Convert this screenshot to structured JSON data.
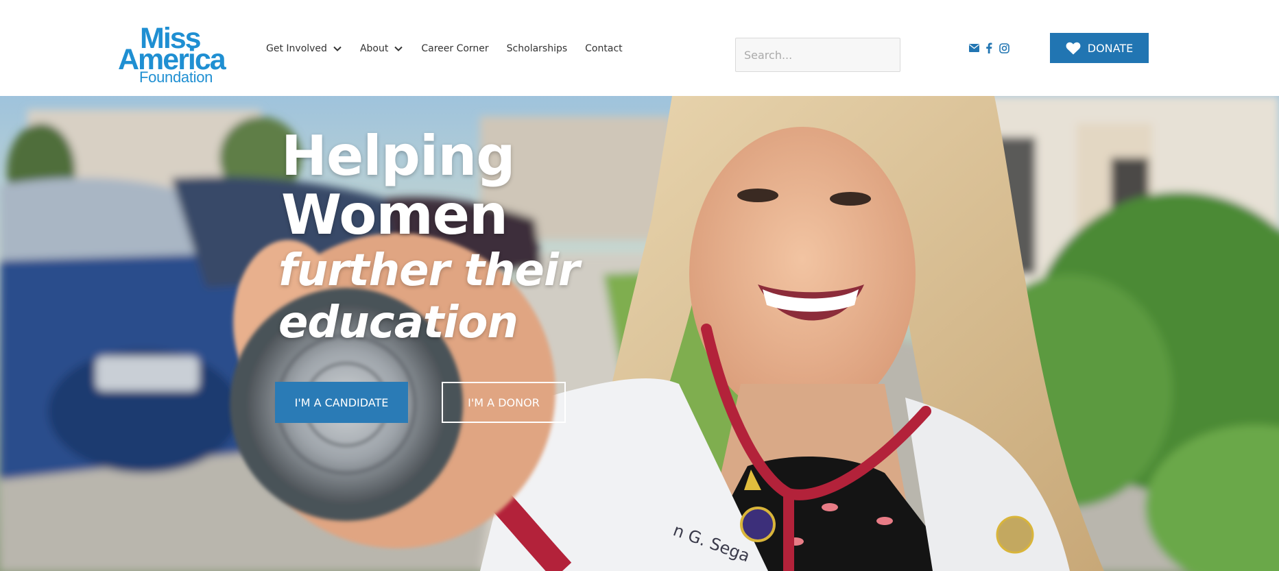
{
  "logo": {
    "line1": "Miss",
    "line2": "America",
    "line3": "Foundation"
  },
  "nav": {
    "items": [
      {
        "label": "Get Involved",
        "has_dropdown": true
      },
      {
        "label": "About",
        "has_dropdown": true
      },
      {
        "label": "Career Corner",
        "has_dropdown": false
      },
      {
        "label": "Scholarships",
        "has_dropdown": false
      },
      {
        "label": "Contact",
        "has_dropdown": false
      }
    ]
  },
  "search": {
    "placeholder": "Search..."
  },
  "social": {
    "icons": [
      "envelope-icon",
      "facebook-icon",
      "instagram-icon"
    ],
    "color": "#2175b2"
  },
  "donate": {
    "label": "DONATE",
    "icon": "heart-icon",
    "color": "#2175b2"
  },
  "hero": {
    "line1": "Helping",
    "line2": "Women",
    "line3": "further their",
    "line4": "education",
    "candidate_button": "I'M A CANDIDATE",
    "donor_button": "I'M A DONOR",
    "badge_text": "n G. Sega"
  },
  "colors": {
    "brand_blue": "#1f8fd2",
    "button_blue": "#2a7bb6"
  }
}
